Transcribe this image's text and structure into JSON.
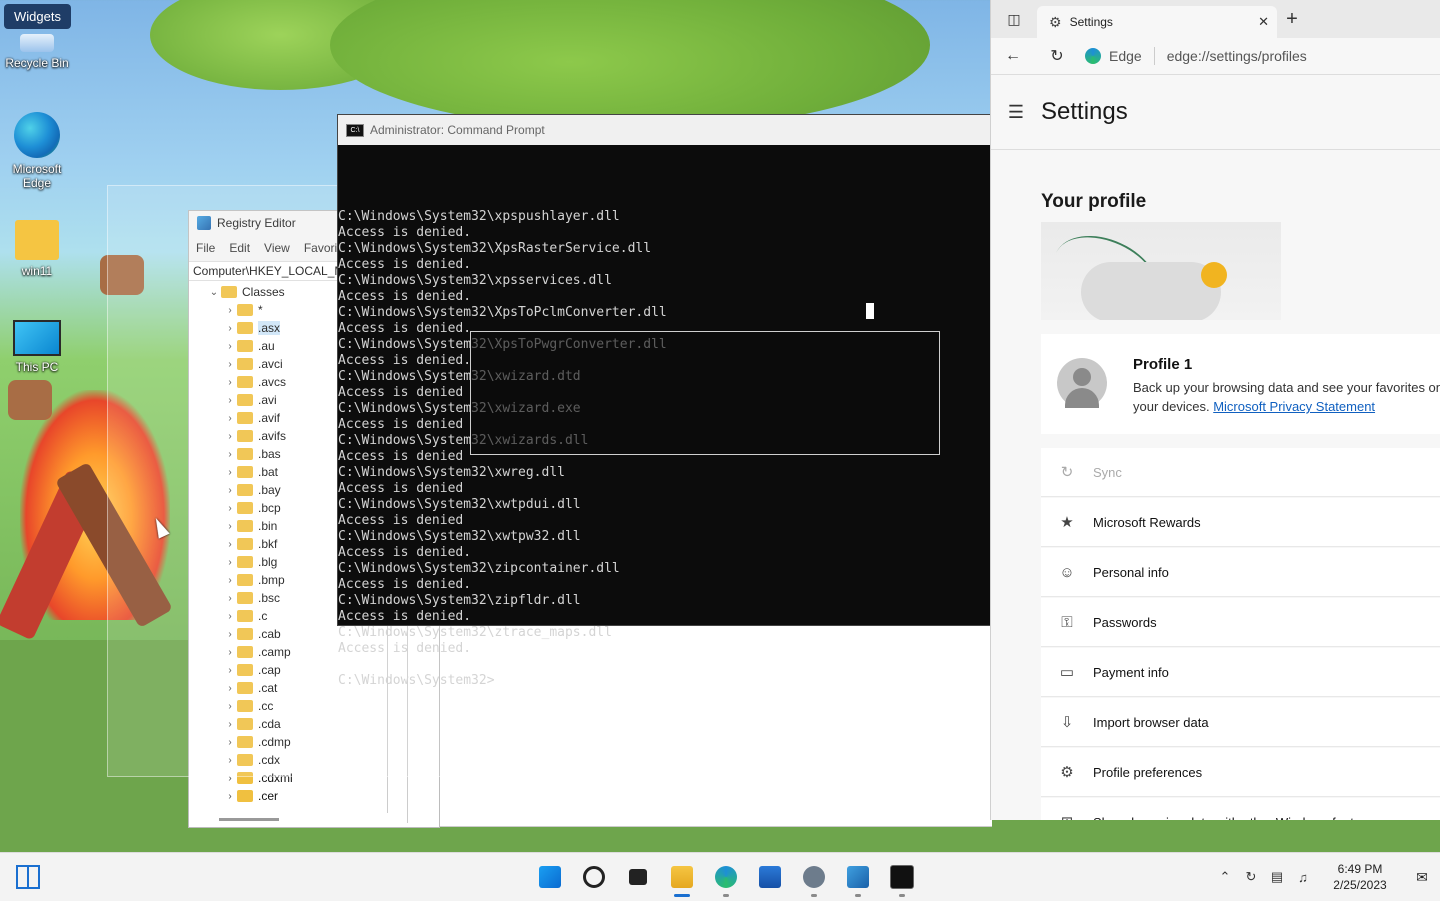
{
  "desktop": {
    "widgets_label": "Widgets",
    "icons": [
      {
        "label": "Recycle Bin",
        "icon": "recycle-bin-icon"
      },
      {
        "label": "Microsoft Edge",
        "icon": "edge-icon"
      },
      {
        "label": "win11",
        "icon": "folder-icon"
      },
      {
        "label": "This PC",
        "icon": "computer-icon"
      }
    ]
  },
  "regedit": {
    "title": "Registry Editor",
    "menu": [
      "File",
      "Edit",
      "View",
      "Favorit"
    ],
    "address": "Computer\\HKEY_LOCAL_M",
    "tree": [
      {
        "label": "Classes",
        "expanded": true
      },
      {
        "label": "*"
      },
      {
        "label": ".asx",
        "selected": true
      },
      {
        "label": ".au"
      },
      {
        "label": ".avci"
      },
      {
        "label": ".avcs"
      },
      {
        "label": ".avi"
      },
      {
        "label": ".avif"
      },
      {
        "label": ".avifs"
      },
      {
        "label": ".bas"
      },
      {
        "label": ".bat"
      },
      {
        "label": ".bay"
      },
      {
        "label": ".bcp"
      },
      {
        "label": ".bin"
      },
      {
        "label": ".bkf"
      },
      {
        "label": ".blg"
      },
      {
        "label": ".bmp"
      },
      {
        "label": ".bsc"
      },
      {
        "label": ".c"
      },
      {
        "label": ".cab"
      },
      {
        "label": ".camp"
      },
      {
        "label": ".cap"
      },
      {
        "label": ".cat"
      },
      {
        "label": ".cc"
      },
      {
        "label": ".cda"
      },
      {
        "label": ".cdmp"
      },
      {
        "label": ".cdx"
      },
      {
        "label": ".cdxml"
      },
      {
        "label": ".cer"
      }
    ]
  },
  "cmd": {
    "title": "Administrator: Command Prompt",
    "lines": [
      "C:\\Windows\\System32\\xpspushlayer.dll",
      "Access is denied.",
      "C:\\Windows\\System32\\XpsRasterService.dll",
      "Access is denied.",
      "C:\\Windows\\System32\\xpsservices.dll",
      "Access is denied.",
      "C:\\Windows\\System32\\XpsToPclmConverter.dll",
      "Access is denied.",
      "C:\\Windows\\System32\\XpsToPwgrConverter.dll",
      "Access is denied.",
      "C:\\Windows\\System32\\xwizard.dtd",
      "Access is denied",
      "C:\\Windows\\System32\\xwizard.exe",
      "Access is denied",
      "C:\\Windows\\System32\\xwizards.dll",
      "Access is denied",
      "C:\\Windows\\System32\\xwreg.dll",
      "Access is denied",
      "C:\\Windows\\System32\\xwtpdui.dll",
      "Access is denied",
      "C:\\Windows\\System32\\xwtpw32.dll",
      "Access is denied.",
      "C:\\Windows\\System32\\zipcontainer.dll",
      "Access is denied.",
      "C:\\Windows\\System32\\zipfldr.dll",
      "Access is denied.",
      "C:\\Windows\\System32\\ztrace_maps.dll",
      "Access is denied.",
      "",
      "C:\\Windows\\System32>"
    ]
  },
  "edge": {
    "tab_title": "Settings",
    "site_label": "Edge",
    "url": "edge://settings/profiles",
    "page_title": "Settings",
    "section_title": "Your profile",
    "profile_name": "Profile 1",
    "profile_desc": "Back up your browsing data and see your favorites on all your devices.",
    "privacy_link": "Microsoft Privacy Statement",
    "menu": [
      {
        "label": "Sync",
        "icon": "sync-icon",
        "disabled": true
      },
      {
        "label": "Microsoft Rewards",
        "icon": "rewards-icon"
      },
      {
        "label": "Personal info",
        "icon": "personal-info-icon"
      },
      {
        "label": "Passwords",
        "icon": "key-icon"
      },
      {
        "label": "Payment info",
        "icon": "card-icon"
      },
      {
        "label": "Import browser data",
        "icon": "import-icon"
      },
      {
        "label": "Profile preferences",
        "icon": "profile-prefs-icon"
      },
      {
        "label": "Share browsing data with other Windows features",
        "icon": "windows-icon"
      }
    ]
  },
  "taskbar": {
    "time": "6:49 PM",
    "date": "2/25/2023",
    "apps": [
      {
        "name": "start-button",
        "icon": "ic-start"
      },
      {
        "name": "search-button",
        "icon": "ic-search"
      },
      {
        "name": "task-view-button",
        "icon": "ic-taskview"
      },
      {
        "name": "file-explorer-button",
        "icon": "ic-files",
        "active": true
      },
      {
        "name": "edge-button",
        "icon": "ic-edge",
        "running": true
      },
      {
        "name": "store-button",
        "icon": "ic-store"
      },
      {
        "name": "settings-button",
        "icon": "ic-settings",
        "running": true
      },
      {
        "name": "regedit-button",
        "icon": "ic-regedit",
        "running": true
      },
      {
        "name": "cmd-button",
        "icon": "ic-cmd",
        "running": true
      }
    ]
  }
}
